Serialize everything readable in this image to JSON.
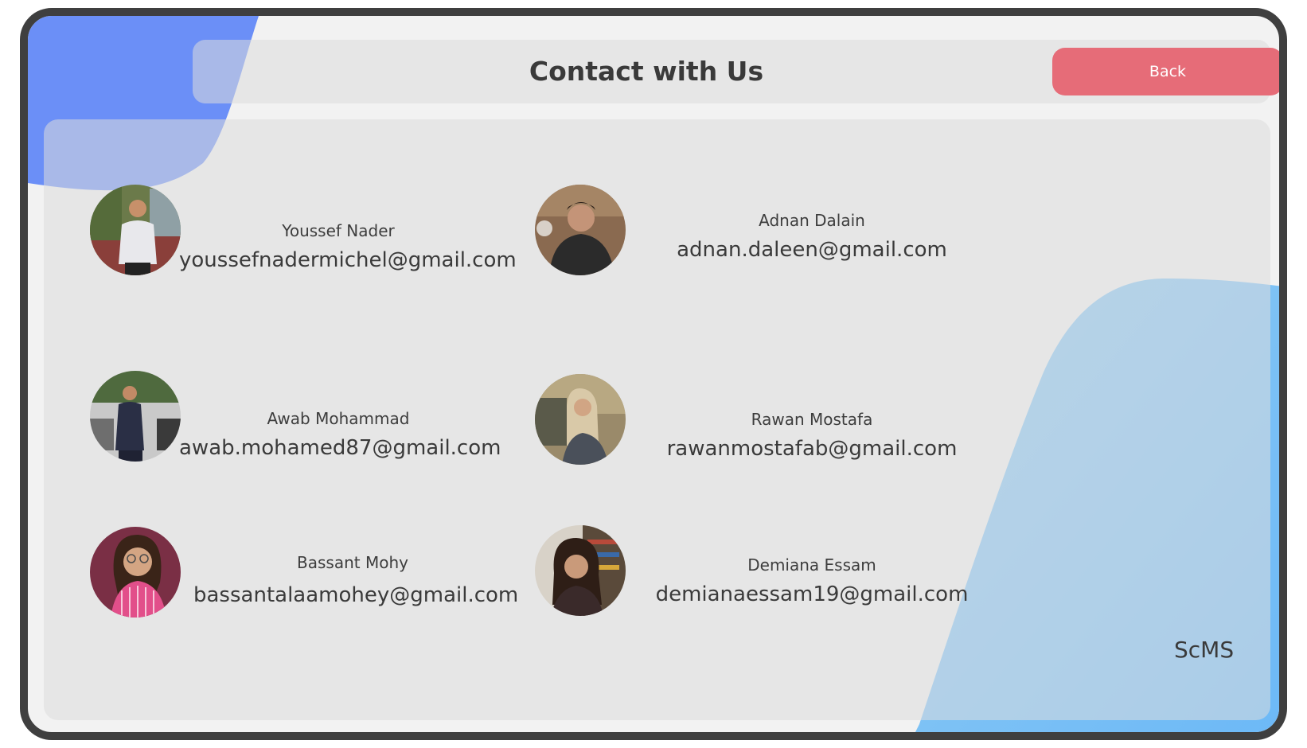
{
  "header": {
    "title": "Contact with Us",
    "back_label": "Back"
  },
  "contacts": [
    {
      "name": "Youssef Nader",
      "email": "youssefnadermichel@gmail.com"
    },
    {
      "name": "Adnan Dalain",
      "email": "adnan.daleen@gmail.com"
    },
    {
      "name": "Awab Mohammad",
      "email": "awab.mohamed87@gmail.com"
    },
    {
      "name": "Rawan Mostafa",
      "email": "rawanmostafab@gmail.com"
    },
    {
      "name": "Bassant Mohy",
      "email": "bassantalaamohey@gmail.com"
    },
    {
      "name": "Demiana Essam",
      "email": "demianaessam19@gmail.com"
    }
  ],
  "brand": "ScMS",
  "colors": {
    "back_button": "#e66c78",
    "blob_top_left": "#6b8ff7",
    "blob_bottom_right": "#7cc4f5",
    "frame_border": "#3f3f3f"
  }
}
